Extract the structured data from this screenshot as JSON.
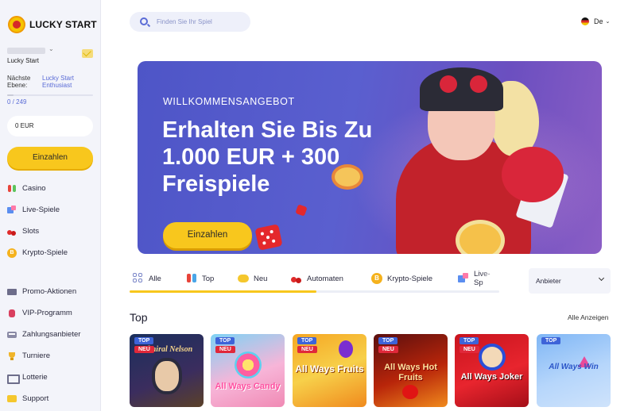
{
  "brand": {
    "name": "LUCKY START"
  },
  "user": {
    "name": "Lucky Start"
  },
  "level": {
    "label": "Nächste Ebene:",
    "value": "Lucky Start Enthusiast",
    "progress_text": "0 / 249",
    "progress_fraction": 0.0
  },
  "balance": {
    "value": "0 EUR"
  },
  "sidebar": {
    "deposit_label": "Einzahlen",
    "games": [
      {
        "label": "Casino",
        "icon": "casino-icon"
      },
      {
        "label": "Live-Spiele",
        "icon": "live-games-icon"
      },
      {
        "label": "Slots",
        "icon": "slots-icon"
      },
      {
        "label": "Krypto-Spiele",
        "icon": "crypto-icon"
      }
    ],
    "more": [
      {
        "label": "Promo-Aktionen",
        "icon": "promo-icon"
      },
      {
        "label": "VIP-Programm",
        "icon": "vip-icon"
      },
      {
        "label": "Zahlungsanbieter",
        "icon": "payment-icon"
      },
      {
        "label": "Turniere",
        "icon": "trophy-icon"
      },
      {
        "label": "Lotterie",
        "icon": "lottery-icon"
      },
      {
        "label": "Support",
        "icon": "support-icon"
      }
    ]
  },
  "search": {
    "placeholder": "Finden Sie Ihr Spiel"
  },
  "language": {
    "value": "De"
  },
  "hero": {
    "kicker": "WILLKOMMENSANGEBOT",
    "title": "Erhalten Sie Bis Zu 1.000 EUR + 300 Freispiele",
    "button_label": "Einzahlen"
  },
  "tabs": [
    {
      "label": "Alle",
      "active": true
    },
    {
      "label": "Top"
    },
    {
      "label": "Neu"
    },
    {
      "label": "Automaten"
    },
    {
      "label": "Krypto-Spiele"
    },
    {
      "label": "Live-Sp"
    }
  ],
  "provider_filter": {
    "label": "Anbieter"
  },
  "section": {
    "title": "Top",
    "see_all": "Alle Anzeigen"
  },
  "games": [
    {
      "name": "Admiral Nelson",
      "badges": [
        "TOP",
        "NEU"
      ]
    },
    {
      "name": "All Ways Candy",
      "badges": [
        "TOP",
        "NEU"
      ]
    },
    {
      "name": "All Ways Fruits",
      "badges": [
        "TOP",
        "NEU"
      ]
    },
    {
      "name": "All Ways Hot Fruits",
      "badges": [
        "TOP",
        "NEU"
      ]
    },
    {
      "name": "All Ways Joker",
      "badges": [
        "TOP",
        "NEU"
      ]
    },
    {
      "name": "All Ways Win",
      "badges": [
        "TOP"
      ]
    }
  ],
  "colors": {
    "accent_yellow": "#f8c71d",
    "hero_purple": "#5a5fcf",
    "link_blue": "#5a6bd6"
  }
}
